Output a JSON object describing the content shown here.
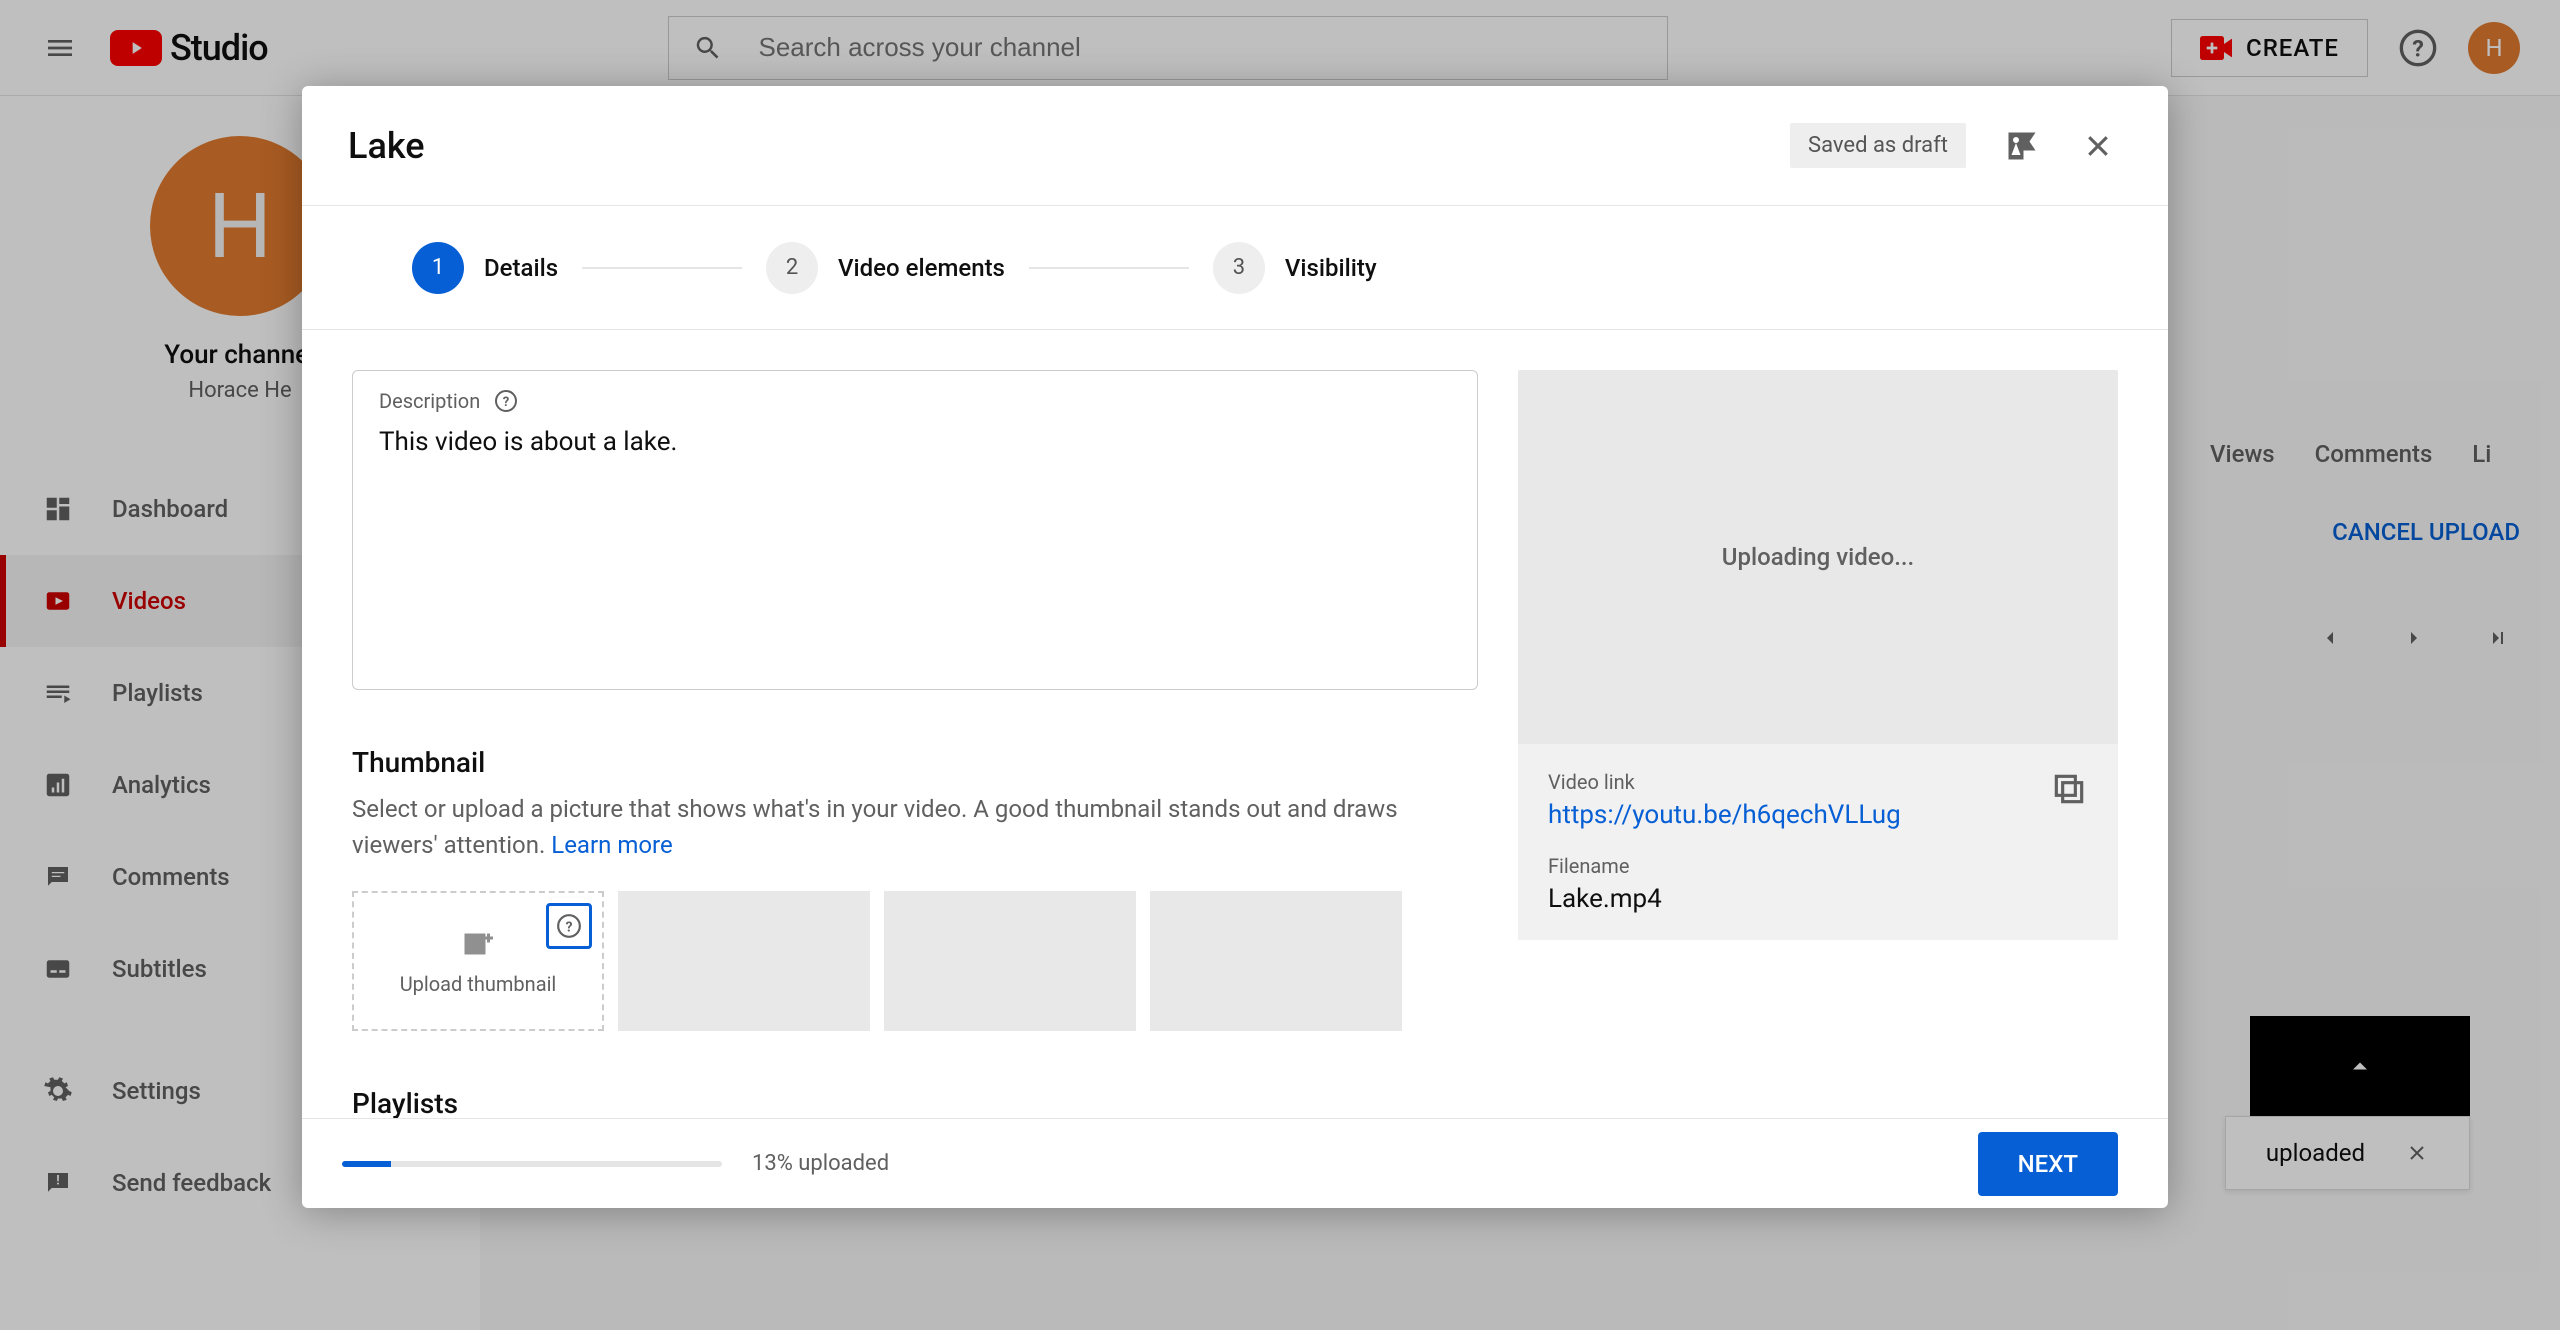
{
  "header": {
    "logo_text": "Studio",
    "search_placeholder": "Search across your channel",
    "create_label": "CREATE",
    "avatar_letter": "H"
  },
  "sidebar": {
    "channel_avatar_letter": "H",
    "channel_label": "Your channel",
    "channel_owner": "Horace He",
    "items": [
      {
        "label": "Dashboard"
      },
      {
        "label": "Videos"
      },
      {
        "label": "Playlists"
      },
      {
        "label": "Analytics"
      },
      {
        "label": "Comments"
      },
      {
        "label": "Subtitles"
      },
      {
        "label": "Settings"
      },
      {
        "label": "Send feedback"
      }
    ]
  },
  "background": {
    "tabs": [
      "Views",
      "Comments",
      "Li"
    ],
    "cancel_upload": "CANCEL UPLOAD",
    "toast_text": "uploaded"
  },
  "modal": {
    "title": "Lake",
    "saved_badge": "Saved as draft",
    "steps": [
      {
        "num": "1",
        "label": "Details"
      },
      {
        "num": "2",
        "label": "Video elements"
      },
      {
        "num": "3",
        "label": "Visibility"
      }
    ],
    "description": {
      "label": "Description",
      "value": "This video is about a lake."
    },
    "thumbnail": {
      "title": "Thumbnail",
      "subtitle": "Select or upload a picture that shows what's in your video. A good thumbnail stands out and draws viewers' attention. ",
      "learn_more": "Learn more",
      "upload_label": "Upload thumbnail"
    },
    "playlists_title": "Playlists",
    "preview": {
      "status": "Uploading video...",
      "link_label": "Video link",
      "link_value": "https://youtu.be/h6qechVLLug",
      "filename_label": "Filename",
      "filename_value": "Lake.mp4"
    },
    "progress": {
      "percent": 13,
      "text": "13% uploaded"
    },
    "next_label": "NEXT"
  }
}
